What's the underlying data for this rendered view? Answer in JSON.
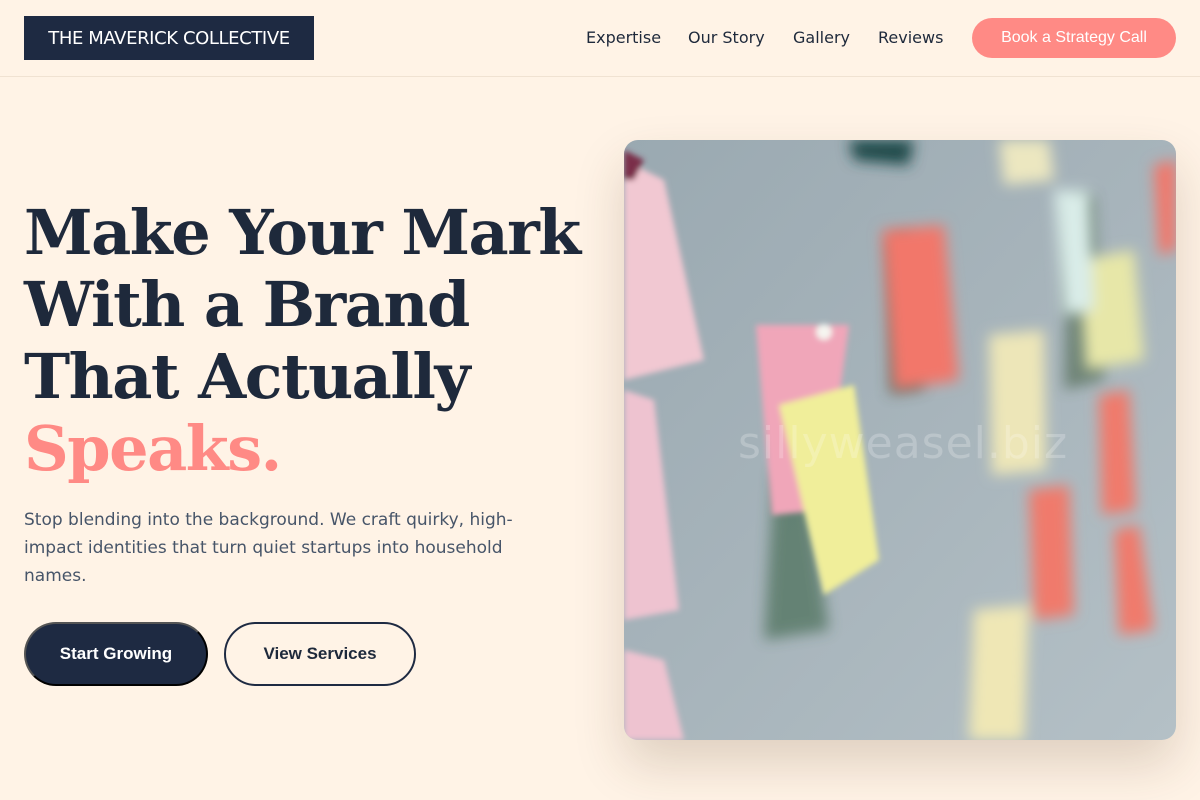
{
  "header": {
    "logo": "THE MAVERICK COLLECTIVE",
    "nav": [
      "Expertise",
      "Our Story",
      "Gallery",
      "Reviews"
    ],
    "cta": "Book a Strategy Call"
  },
  "hero": {
    "headline_lines": [
      "Make Your Mark",
      "With a Brand",
      "That Actually"
    ],
    "headline_accent": "Speaks.",
    "subtitle": "Stop blending into the background. We craft quirky, high-impact identities that turn quiet startups into household names.",
    "primary_button": "Start Growing",
    "secondary_button": "View Services",
    "image_watermark": "sillyweasel.biz"
  },
  "colors": {
    "background": "#fff3e6",
    "navy": "#1e2a42",
    "accent": "#ff8a85"
  }
}
